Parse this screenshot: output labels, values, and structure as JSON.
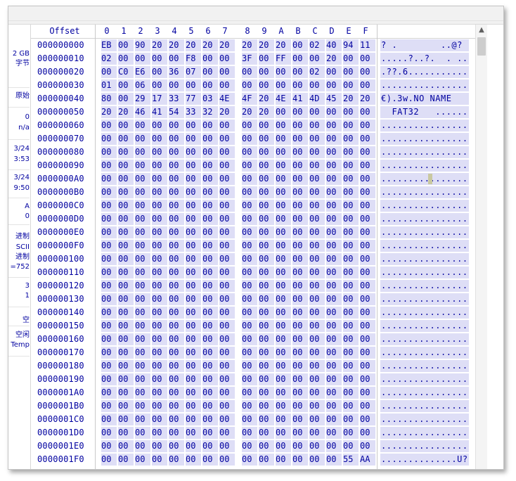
{
  "hex_header": {
    "offset_label": "Offset",
    "columns": [
      "0",
      "1",
      "2",
      "3",
      "4",
      "5",
      "6",
      "7",
      "8",
      "9",
      "A",
      "B",
      "C",
      "D",
      "E",
      "F"
    ]
  },
  "sidebar": {
    "items": [
      {
        "text": "2 GB"
      },
      {
        "text": "字节"
      },
      {
        "text": "原始"
      },
      {
        "text": "0"
      },
      {
        "text": "n/a"
      },
      {
        "text": "3/24"
      },
      {
        "text": "3:53"
      },
      {
        "text": "3/24"
      },
      {
        "text": "9:50"
      },
      {
        "text": "A"
      },
      {
        "text": "0"
      },
      {
        "text": "进制"
      },
      {
        "text": "SCII"
      },
      {
        "text": "进制"
      },
      {
        "text": "=752"
      },
      {
        "text": "3"
      },
      {
        "text": "1"
      },
      {
        "text": "空"
      },
      {
        "text": "空闲"
      },
      {
        "text": "Temp"
      }
    ]
  },
  "rows": [
    {
      "offset": "000000000",
      "bytes": [
        "EB",
        "00",
        "90",
        "20",
        "20",
        "20",
        "20",
        "20",
        "20",
        "20",
        "20",
        "00",
        "02",
        "40",
        "94",
        "11"
      ],
      "ascii": "? .        ..@?"
    },
    {
      "offset": "000000010",
      "bytes": [
        "02",
        "00",
        "00",
        "00",
        "00",
        "F8",
        "00",
        "00",
        "3F",
        "00",
        "FF",
        "00",
        "00",
        "20",
        "00",
        "00"
      ],
      "ascii": ".....?..?.  . .."
    },
    {
      "offset": "000000020",
      "bytes": [
        "00",
        "C0",
        "E6",
        "00",
        "36",
        "07",
        "00",
        "00",
        "00",
        "00",
        "00",
        "00",
        "02",
        "00",
        "00",
        "00"
      ],
      "ascii": ".??.6..........."
    },
    {
      "offset": "000000030",
      "bytes": [
        "01",
        "00",
        "06",
        "00",
        "00",
        "00",
        "00",
        "00",
        "00",
        "00",
        "00",
        "00",
        "00",
        "00",
        "00",
        "00"
      ],
      "ascii": "................"
    },
    {
      "offset": "000000040",
      "bytes": [
        "80",
        "00",
        "29",
        "17",
        "33",
        "77",
        "03",
        "4E",
        "4F",
        "20",
        "4E",
        "41",
        "4D",
        "45",
        "20",
        "20"
      ],
      "ascii": "€).3w.NO NAME"
    },
    {
      "offset": "000000050",
      "bytes": [
        "20",
        "20",
        "46",
        "41",
        "54",
        "33",
        "32",
        "20",
        "20",
        "20",
        "00",
        "00",
        "00",
        "00",
        "00",
        "00"
      ],
      "ascii": "  FAT32   ......"
    },
    {
      "offset": "000000060",
      "bytes": [
        "00",
        "00",
        "00",
        "00",
        "00",
        "00",
        "00",
        "00",
        "00",
        "00",
        "00",
        "00",
        "00",
        "00",
        "00",
        "00"
      ],
      "ascii": "................"
    },
    {
      "offset": "000000070",
      "bytes": [
        "00",
        "00",
        "00",
        "00",
        "00",
        "00",
        "00",
        "00",
        "00",
        "00",
        "00",
        "00",
        "00",
        "00",
        "00",
        "00"
      ],
      "ascii": "................"
    },
    {
      "offset": "000000080",
      "bytes": [
        "00",
        "00",
        "00",
        "00",
        "00",
        "00",
        "00",
        "00",
        "00",
        "00",
        "00",
        "00",
        "00",
        "00",
        "00",
        "00"
      ],
      "ascii": "................"
    },
    {
      "offset": "000000090",
      "bytes": [
        "00",
        "00",
        "00",
        "00",
        "00",
        "00",
        "00",
        "00",
        "00",
        "00",
        "00",
        "00",
        "00",
        "00",
        "00",
        "00"
      ],
      "ascii": "................"
    },
    {
      "offset": "0000000A0",
      "bytes": [
        "00",
        "00",
        "00",
        "00",
        "00",
        "00",
        "00",
        "00",
        "00",
        "00",
        "00",
        "00",
        "00",
        "00",
        "00",
        "00"
      ],
      "ascii": "................"
    },
    {
      "offset": "0000000B0",
      "bytes": [
        "00",
        "00",
        "00",
        "00",
        "00",
        "00",
        "00",
        "00",
        "00",
        "00",
        "00",
        "00",
        "00",
        "00",
        "00",
        "00"
      ],
      "ascii": "................"
    },
    {
      "offset": "0000000C0",
      "bytes": [
        "00",
        "00",
        "00",
        "00",
        "00",
        "00",
        "00",
        "00",
        "00",
        "00",
        "00",
        "00",
        "00",
        "00",
        "00",
        "00"
      ],
      "ascii": "................"
    },
    {
      "offset": "0000000D0",
      "bytes": [
        "00",
        "00",
        "00",
        "00",
        "00",
        "00",
        "00",
        "00",
        "00",
        "00",
        "00",
        "00",
        "00",
        "00",
        "00",
        "00"
      ],
      "ascii": "................"
    },
    {
      "offset": "0000000E0",
      "bytes": [
        "00",
        "00",
        "00",
        "00",
        "00",
        "00",
        "00",
        "00",
        "00",
        "00",
        "00",
        "00",
        "00",
        "00",
        "00",
        "00"
      ],
      "ascii": "................"
    },
    {
      "offset": "0000000F0",
      "bytes": [
        "00",
        "00",
        "00",
        "00",
        "00",
        "00",
        "00",
        "00",
        "00",
        "00",
        "00",
        "00",
        "00",
        "00",
        "00",
        "00"
      ],
      "ascii": "................"
    },
    {
      "offset": "000000100",
      "bytes": [
        "00",
        "00",
        "00",
        "00",
        "00",
        "00",
        "00",
        "00",
        "00",
        "00",
        "00",
        "00",
        "00",
        "00",
        "00",
        "00"
      ],
      "ascii": "................"
    },
    {
      "offset": "000000110",
      "bytes": [
        "00",
        "00",
        "00",
        "00",
        "00",
        "00",
        "00",
        "00",
        "00",
        "00",
        "00",
        "00",
        "00",
        "00",
        "00",
        "00"
      ],
      "ascii": "................"
    },
    {
      "offset": "000000120",
      "bytes": [
        "00",
        "00",
        "00",
        "00",
        "00",
        "00",
        "00",
        "00",
        "00",
        "00",
        "00",
        "00",
        "00",
        "00",
        "00",
        "00"
      ],
      "ascii": "................"
    },
    {
      "offset": "000000130",
      "bytes": [
        "00",
        "00",
        "00",
        "00",
        "00",
        "00",
        "00",
        "00",
        "00",
        "00",
        "00",
        "00",
        "00",
        "00",
        "00",
        "00"
      ],
      "ascii": "................"
    },
    {
      "offset": "000000140",
      "bytes": [
        "00",
        "00",
        "00",
        "00",
        "00",
        "00",
        "00",
        "00",
        "00",
        "00",
        "00",
        "00",
        "00",
        "00",
        "00",
        "00"
      ],
      "ascii": "................"
    },
    {
      "offset": "000000150",
      "bytes": [
        "00",
        "00",
        "00",
        "00",
        "00",
        "00",
        "00",
        "00",
        "00",
        "00",
        "00",
        "00",
        "00",
        "00",
        "00",
        "00"
      ],
      "ascii": "................"
    },
    {
      "offset": "000000160",
      "bytes": [
        "00",
        "00",
        "00",
        "00",
        "00",
        "00",
        "00",
        "00",
        "00",
        "00",
        "00",
        "00",
        "00",
        "00",
        "00",
        "00"
      ],
      "ascii": "................"
    },
    {
      "offset": "000000170",
      "bytes": [
        "00",
        "00",
        "00",
        "00",
        "00",
        "00",
        "00",
        "00",
        "00",
        "00",
        "00",
        "00",
        "00",
        "00",
        "00",
        "00"
      ],
      "ascii": "................"
    },
    {
      "offset": "000000180",
      "bytes": [
        "00",
        "00",
        "00",
        "00",
        "00",
        "00",
        "00",
        "00",
        "00",
        "00",
        "00",
        "00",
        "00",
        "00",
        "00",
        "00"
      ],
      "ascii": "................"
    },
    {
      "offset": "000000190",
      "bytes": [
        "00",
        "00",
        "00",
        "00",
        "00",
        "00",
        "00",
        "00",
        "00",
        "00",
        "00",
        "00",
        "00",
        "00",
        "00",
        "00"
      ],
      "ascii": "................"
    },
    {
      "offset": "0000001A0",
      "bytes": [
        "00",
        "00",
        "00",
        "00",
        "00",
        "00",
        "00",
        "00",
        "00",
        "00",
        "00",
        "00",
        "00",
        "00",
        "00",
        "00"
      ],
      "ascii": "................"
    },
    {
      "offset": "0000001B0",
      "bytes": [
        "00",
        "00",
        "00",
        "00",
        "00",
        "00",
        "00",
        "00",
        "00",
        "00",
        "00",
        "00",
        "00",
        "00",
        "00",
        "00"
      ],
      "ascii": "................"
    },
    {
      "offset": "0000001C0",
      "bytes": [
        "00",
        "00",
        "00",
        "00",
        "00",
        "00",
        "00",
        "00",
        "00",
        "00",
        "00",
        "00",
        "00",
        "00",
        "00",
        "00"
      ],
      "ascii": "................"
    },
    {
      "offset": "0000001D0",
      "bytes": [
        "00",
        "00",
        "00",
        "00",
        "00",
        "00",
        "00",
        "00",
        "00",
        "00",
        "00",
        "00",
        "00",
        "00",
        "00",
        "00"
      ],
      "ascii": "................"
    },
    {
      "offset": "0000001E0",
      "bytes": [
        "00",
        "00",
        "00",
        "00",
        "00",
        "00",
        "00",
        "00",
        "00",
        "00",
        "00",
        "00",
        "00",
        "00",
        "00",
        "00"
      ],
      "ascii": "................"
    },
    {
      "offset": "0000001F0",
      "bytes": [
        "00",
        "00",
        "00",
        "00",
        "00",
        "00",
        "00",
        "00",
        "00",
        "00",
        "00",
        "00",
        "00",
        "00",
        "55",
        "AA"
      ],
      "ascii": "..............U?"
    }
  ],
  "scrollbar": {
    "up_glyph": "▲"
  },
  "colors": {
    "text": "#0000a0",
    "highlight": "#dedef6",
    "cursor": "#c9c8a0"
  },
  "icons": {
    "scroll_up": "triangle-up-icon"
  }
}
